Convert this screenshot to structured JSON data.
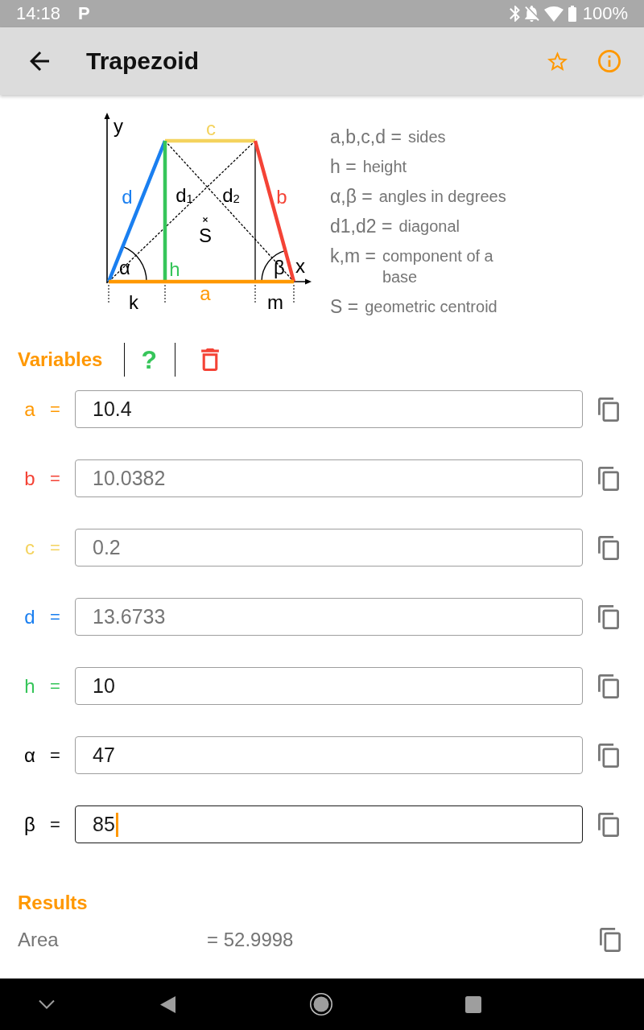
{
  "status_bar": {
    "time": "14:18",
    "notification": "P",
    "battery": "100%"
  },
  "app_bar": {
    "title": "Trapezoid",
    "favorite": false
  },
  "diagram": {
    "labels": [
      {
        "text": "y",
        "color": "#000000"
      },
      {
        "text": "c",
        "color": "#f4d35e"
      },
      {
        "text": "d",
        "color": "#1a7ff0"
      },
      {
        "text": "d$_{1}$",
        "color": "#000000"
      },
      {
        "text": "d$_{2}$",
        "color": "#000000"
      },
      {
        "text": "b",
        "color": "#f44336"
      },
      {
        "text": "S",
        "color": "#000000"
      },
      {
        "text": "α",
        "color": "#000000"
      },
      {
        "text": "h",
        "color": "#36c55a"
      },
      {
        "text": "β",
        "color": "#000000"
      },
      {
        "text": "x",
        "color": "#000000"
      },
      {
        "text": "k",
        "color": "#000000"
      },
      {
        "text": "a",
        "color": "#ff9800"
      },
      {
        "text": "m",
        "color": "#000000"
      }
    ]
  },
  "legend": [
    {
      "term": "a,b,c,d =",
      "description": "sides"
    },
    {
      "term": "h =",
      "description": "height"
    },
    {
      "term": "α,β =",
      "description": "angles in degrees"
    },
    {
      "term": "d1,d2 =",
      "description": "diagonal"
    },
    {
      "term": "k,m =",
      "description": "component of a base"
    },
    {
      "term": "S =",
      "description": "geometric centroid"
    }
  ],
  "variables": {
    "title": "Variables",
    "help": "?",
    "rows": [
      {
        "symbol": "a",
        "sign": "=",
        "color": "#ff9800",
        "value": "10.4",
        "focused": false
      },
      {
        "symbol": "b",
        "sign": "=",
        "color": "#f44336",
        "placeholder": "10.0382",
        "focused": false
      },
      {
        "symbol": "c",
        "sign": "=",
        "color": "#f4d35e",
        "placeholder": "0.2",
        "focused": false
      },
      {
        "symbol": "d",
        "sign": "=",
        "color": "#1a7ff0",
        "placeholder": "13.6733",
        "focused": false
      },
      {
        "symbol": "h",
        "sign": "=",
        "color": "#36c55a",
        "value": "10",
        "focused": false
      },
      {
        "symbol": "α",
        "sign": "=",
        "color": "#000000",
        "value": "47",
        "focused": false
      },
      {
        "symbol": "β",
        "sign": "=",
        "color": "#000000",
        "value": "85",
        "focused": true
      }
    ]
  },
  "results": {
    "title": "Results",
    "rows": [
      {
        "label": "Area",
        "value": "= 52.9998"
      }
    ]
  }
}
